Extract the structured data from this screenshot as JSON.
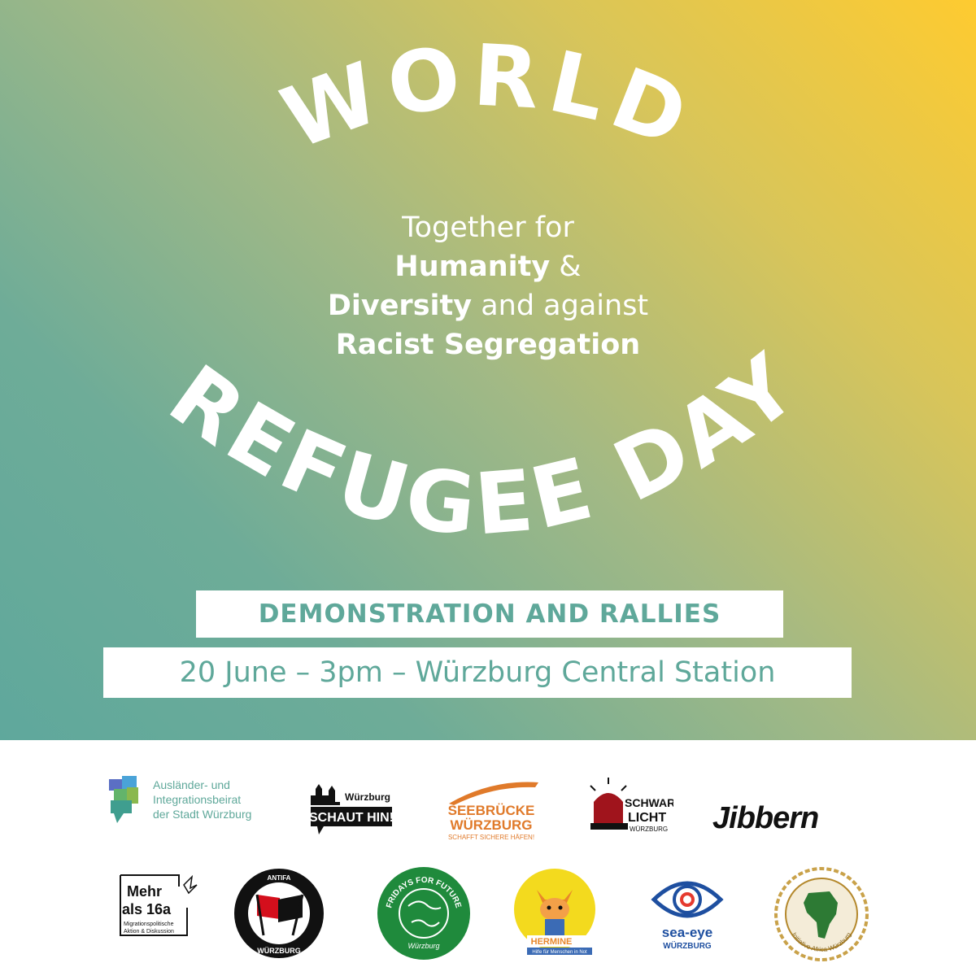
{
  "poster": {
    "headline_top": "WORLD",
    "headline_bottom": "REFUGEE DAY",
    "subtitle": {
      "line1": "Together for",
      "line2_bold": "Humanity",
      "line2_rest": " &",
      "line3_bold": "Diversity",
      "line3_rest": " and against",
      "line4_bold": "Racist Segregation"
    },
    "event_title": "DEMONSTRATION AND RALLIES",
    "event_details": "20 June – 3pm – Würzburg Central Station",
    "colors": {
      "gradient_start": "#5fa89c",
      "gradient_end": "#fecb30",
      "text_accent": "#5fa89a"
    }
  },
  "supporters": [
    {
      "icon": "speech-bubble-map-icon",
      "lines": [
        "Ausländer- und",
        "Integrationsbeirat",
        "der Stadt Würzburg"
      ]
    },
    {
      "icon": "city-skyline-icon",
      "lines": [
        "Würzburg",
        "SCHAUT HIN!"
      ]
    },
    {
      "icon": "bridge-icon",
      "lines": [
        "SEEBRÜCKE",
        "WÜRZBURG",
        "SCHAFFT SICHERE HÄFEN!"
      ]
    },
    {
      "icon": "siren-light-icon",
      "lines": [
        "SCHWARZ",
        "LICHT",
        "WÜRZBURG"
      ]
    },
    {
      "icon": "wordmark",
      "lines": [
        "Jibbern"
      ]
    },
    {
      "icon": "origami-bird-icon",
      "lines": [
        "Mehr",
        "als 16a",
        "Migrationspolitische",
        "Aktion & Diskussion"
      ]
    },
    {
      "icon": "antifa-flags-icon",
      "lines": [
        "ANTIFA",
        "WÜRZBURG"
      ]
    },
    {
      "icon": "globe-icon",
      "lines": [
        "FRIDAYS FOR FUTURE",
        "Würzburg"
      ]
    },
    {
      "icon": "fox-icon",
      "lines": [
        "HERMINE",
        "Hilfe für Menschen in Not"
      ]
    },
    {
      "icon": "eye-icon",
      "lines": [
        "sea-eye",
        "WÜRZBURG"
      ]
    },
    {
      "icon": "africa-map-icon",
      "lines": [
        "Initiative Africa Würzburg"
      ]
    }
  ]
}
